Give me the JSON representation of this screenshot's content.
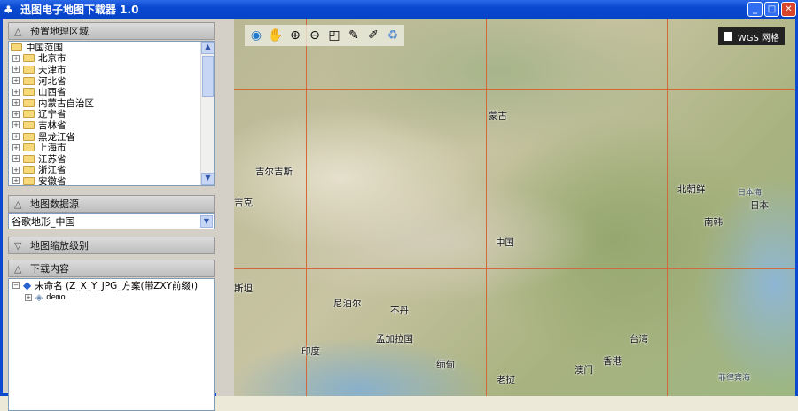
{
  "window": {
    "title": "迅图电子地图下载器 1.0",
    "min": "_",
    "max": "□",
    "close": "✕"
  },
  "panels": {
    "preset_region": {
      "title": "预置地理区域",
      "root": "中国范围",
      "items": [
        "北京市",
        "天津市",
        "河北省",
        "山西省",
        "内蒙古自治区",
        "辽宁省",
        "吉林省",
        "黑龙江省",
        "上海市",
        "江苏省",
        "浙江省",
        "安徽省"
      ]
    },
    "data_source": {
      "title": "地图数据源",
      "value": "谷歌地形_中国"
    },
    "zoom_level": {
      "title": "地图缩放级别"
    },
    "download": {
      "title": "下载内容",
      "task": "未命名 (Z_X_Y_JPG_方案(带ZXY前缀))",
      "child": "demo"
    }
  },
  "map": {
    "wgs_grid_label": "WGS 网格",
    "labels": [
      "蒙古",
      "中国",
      "北朝鲜",
      "南韩",
      "日本",
      "日本海",
      "吉尔吉斯",
      "吉克",
      "斯坦",
      "尼泊尔",
      "不丹",
      "孟加拉国",
      "印度",
      "缅甸",
      "老挝",
      "台湾",
      "香港",
      "澳门",
      "菲律宾海"
    ]
  }
}
